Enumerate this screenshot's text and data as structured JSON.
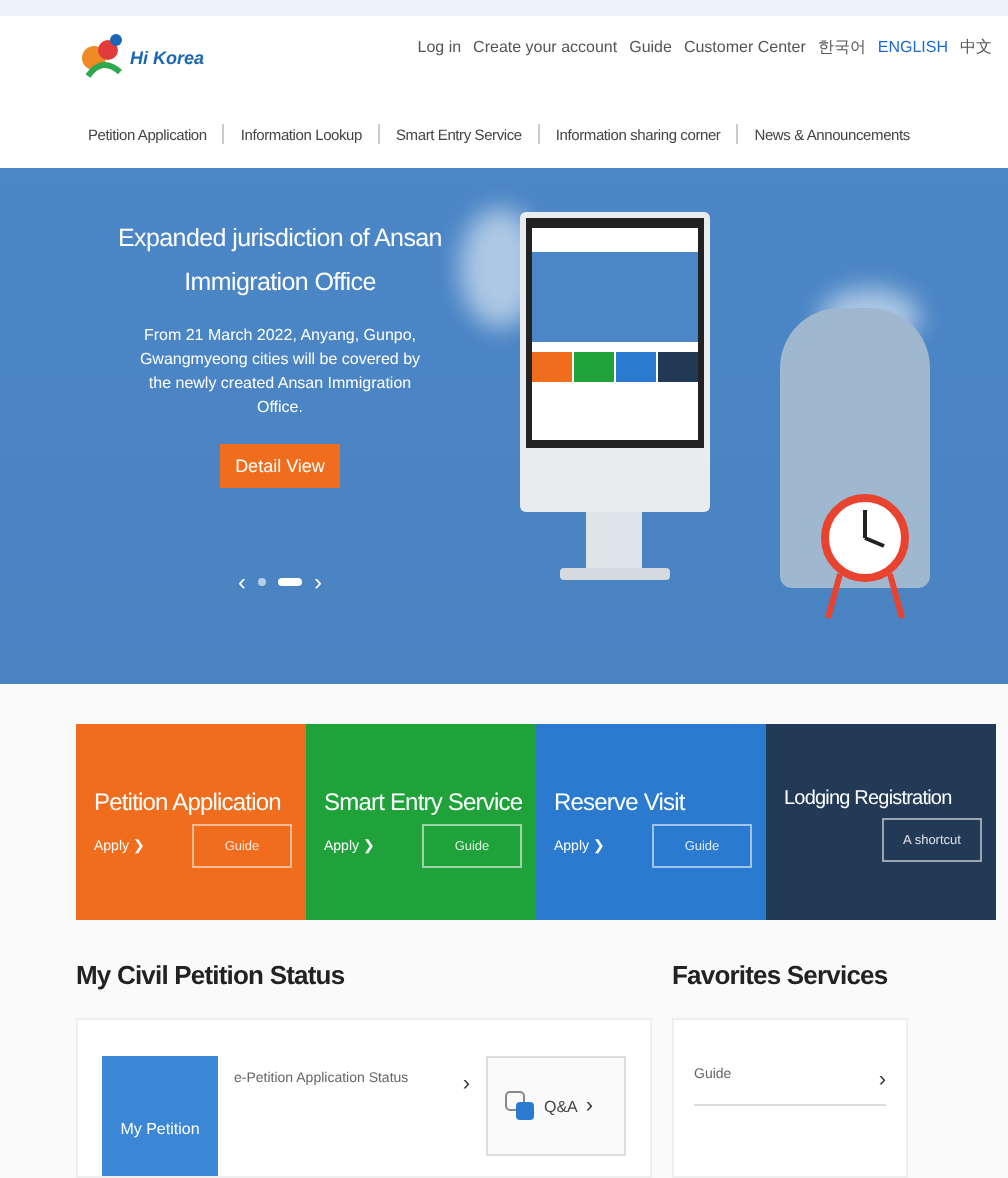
{
  "header": {
    "logo_text": "Hi Korea",
    "top_links": [
      {
        "label": "Log in",
        "kind": "link"
      },
      {
        "label": "Create your account",
        "kind": "link"
      },
      {
        "label": "Guide",
        "kind": "link"
      },
      {
        "label": "Customer Center",
        "kind": "link"
      },
      {
        "label": "한국어",
        "kind": "lang",
        "selected": false
      },
      {
        "label": "ENGLISH",
        "kind": "lang",
        "selected": true
      },
      {
        "label": "中文",
        "kind": "lang",
        "selected": false
      }
    ],
    "nav": [
      "Petition Application",
      "Information Lookup",
      "Smart Entry Service",
      "Information sharing corner",
      "News & Announcements"
    ]
  },
  "banner": {
    "title": "Expanded jurisdiction of Ansan Immigration Office",
    "text": "From 21 March 2022, Anyang, Gunpo, Gwangmyeong cities will be covered by the newly created Ansan Immigration Office.",
    "button": "Detail View",
    "prev": "‹",
    "next": "›",
    "slides": [
      {
        "selected": false
      },
      {
        "selected": true
      }
    ]
  },
  "tiles": [
    {
      "title": "Petition Application",
      "link": "Apply",
      "chevron": "❯",
      "button": "Guide",
      "color": "#ef6d1c"
    },
    {
      "title": "Smart Entry Service",
      "link": "Apply",
      "chevron": "❯",
      "button": "Guide",
      "color": "#1fa23a"
    },
    {
      "title": "Reserve Visit",
      "link": "Apply",
      "chevron": "❯",
      "button": "Guide",
      "color": "#2a7ad0"
    },
    {
      "title": "Lodging Registration",
      "button": "A shortcut",
      "color": "#233a57"
    }
  ],
  "status": {
    "heading": "My Civil Petition Status",
    "my_petition": "My Petition",
    "items": [
      {
        "label": "e-Petition Application Status",
        "arrow": "›"
      }
    ],
    "qa": {
      "label": "Q&A",
      "arrow": "›"
    }
  },
  "favorites": {
    "heading": "Favorites Services",
    "items": [
      {
        "label": "Guide",
        "arrow": "›"
      }
    ]
  }
}
